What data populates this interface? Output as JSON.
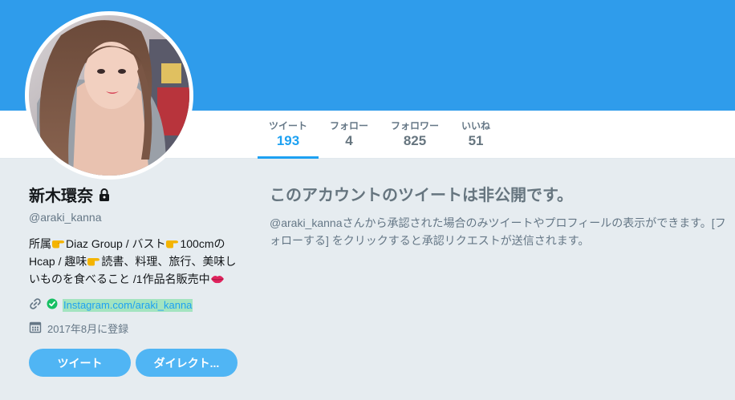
{
  "stats": [
    {
      "label": "ツイート",
      "value": "193",
      "active": true
    },
    {
      "label": "フォロー",
      "value": "4",
      "active": false
    },
    {
      "label": "フォロワー",
      "value": "825",
      "active": false
    },
    {
      "label": "いいね",
      "value": "51",
      "active": false
    }
  ],
  "profile": {
    "name": "新木環奈",
    "handle": "@araki_kanna",
    "bio_line1_a": "所属",
    "bio_line1_b": "Diaz Group / バスト",
    "bio_line1_c": "100cmの",
    "bio_line2_a": "Hcap / 趣味",
    "bio_line2_b": "読書、料理、旅行、美味し",
    "bio_line3": "いものを食べること /1作品名販売中",
    "url": "Instagram.com/araki_kanna",
    "joined": "2017年8月に登録"
  },
  "buttons": {
    "tweet": "ツイート",
    "dm": "ダイレクト..."
  },
  "protected": {
    "title": "このアカウントのツイートは非公開です。",
    "text": "@araki_kannaさんから承認された場合のみツイートやプロフィールの表示ができます。[フォローする] をクリックすると承認リクエストが送信されます。"
  },
  "colors": {
    "banner": "#2f9ceb",
    "accent": "#1da1f2",
    "button": "#50b5f4",
    "background": "#e6ecf0"
  },
  "icons": [
    "lock-icon",
    "link-icon",
    "verified-check-icon",
    "calendar-icon",
    "pointing-hand-emoji",
    "kiss-mark-emoji"
  ]
}
